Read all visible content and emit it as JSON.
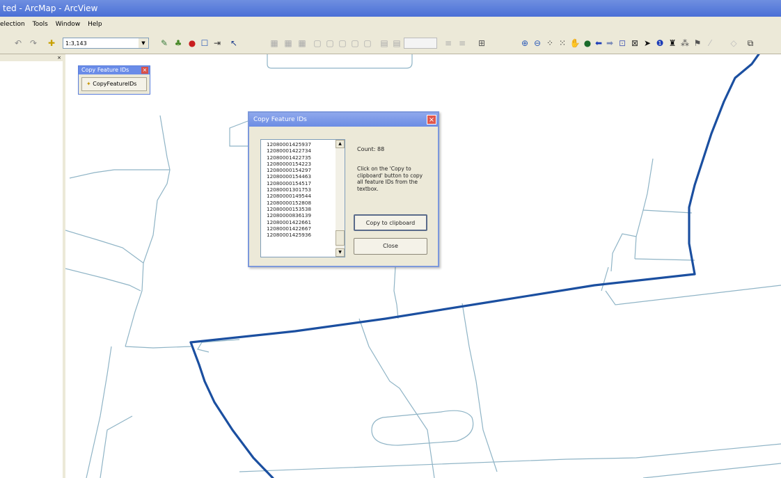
{
  "window": {
    "title": "ted - ArcMap - ArcView"
  },
  "menu": {
    "items": [
      "election",
      "Tools",
      "Window",
      "Help"
    ]
  },
  "toolbar": {
    "scale": "1:3,143"
  },
  "toc": {
    "close_glyph": "×"
  },
  "floating_toolbar": {
    "title": "Copy Feature IDs",
    "button_label": "CopyFeatureIDs"
  },
  "dialog": {
    "title": "Copy Feature IDs",
    "count_text": "Count: 88",
    "instructions": "Click on the 'Copy to clipboard' button to copy all feature IDs from the textbox.",
    "copy_button": "Copy to clipboard",
    "close_button": "Close",
    "feature_ids": [
      "12080001425937",
      "12080001422734",
      "12080001422735",
      "12080000154223",
      "12080000154297",
      "12080000154463",
      "12080000154517",
      "12080001301753",
      "12080000149544",
      "12080000152808",
      "12080000153538",
      "12080000836139",
      "12080001422661",
      "12080001422667",
      "12080001425936"
    ]
  },
  "colors": {
    "boundary": "#1b4fa0",
    "road": "#8fb4c6",
    "chrome": "#ece9d8"
  }
}
